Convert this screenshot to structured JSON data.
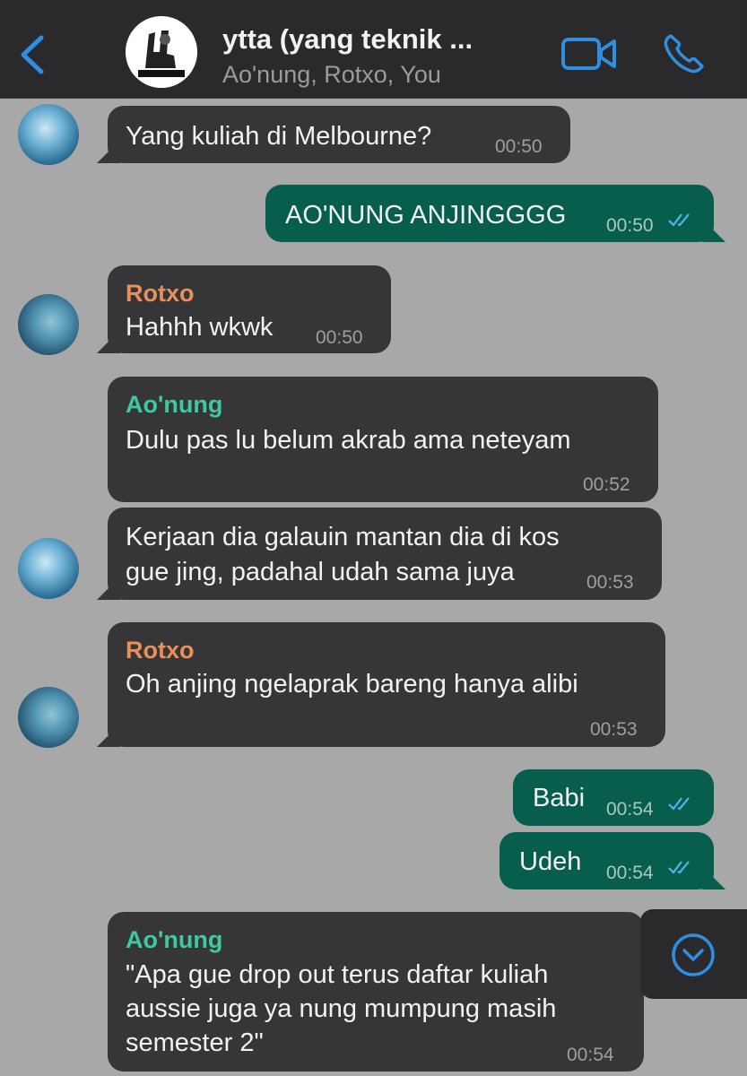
{
  "header": {
    "title": "ytta (yang teknik ...",
    "subtitle": "Ao'nung, Rotxo, You"
  },
  "colors": {
    "accent": "#2f8ee0",
    "outgoing_bubble": "#075e4d",
    "incoming_bubble": "#363638",
    "rotxo_name": "#e7905a",
    "aonung_name": "#3fc9a0",
    "chat_background": "#a8a8a8"
  },
  "messages": [
    {
      "text": "Yang kuliah di Melbourne?",
      "time": "00:50"
    },
    {
      "text": "AO'NUNG ANJINGGGG",
      "time": "00:50"
    },
    {
      "sender": "Rotxo",
      "text": "Hahhh wkwk",
      "time": "00:50"
    },
    {
      "sender": "Ao'nung",
      "text": "Dulu pas lu belum akrab ama neteyam",
      "time": "00:52"
    },
    {
      "line1": "Kerjaan dia galauin mantan dia di kos",
      "line2": "gue jing, padahal udah sama juya",
      "time": "00:53"
    },
    {
      "sender": "Rotxo",
      "text": "Oh anjing ngelaprak bareng hanya alibi",
      "time": "00:53"
    },
    {
      "text": "Babi",
      "time": "00:54"
    },
    {
      "text": "Udeh",
      "time": "00:54"
    },
    {
      "sender": "Ao'nung",
      "line1": "\"Apa gue drop out terus daftar kuliah",
      "line2": "aussie juga ya nung mumpung masih",
      "line3": "semester 2\"",
      "time": "00:54"
    }
  ],
  "icons": {
    "back": "chevron-left-icon",
    "video": "video-camera-icon",
    "call": "phone-icon",
    "scroll": "chevron-down-circle-icon",
    "read": "double-check-icon"
  }
}
